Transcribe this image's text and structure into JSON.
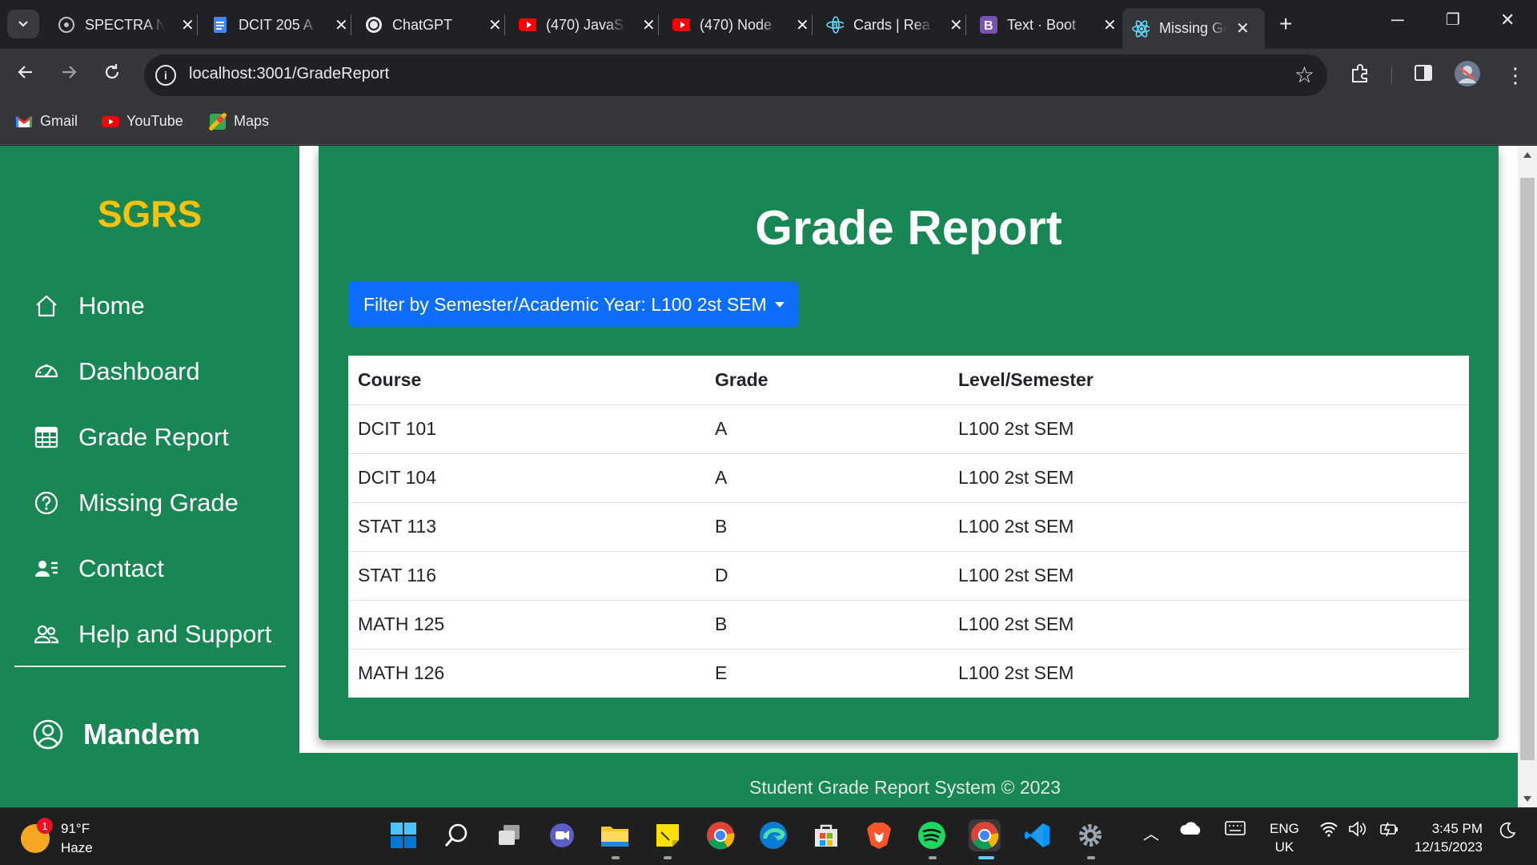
{
  "browser": {
    "tabs": [
      {
        "title": "SPECTRA N",
        "icon": "spectra-icon"
      },
      {
        "title": "DCIT 205 A",
        "icon": "docs-icon"
      },
      {
        "title": "ChatGPT",
        "icon": "chatgpt-icon"
      },
      {
        "title": "(470) JavaS",
        "icon": "youtube-icon"
      },
      {
        "title": "(470) Node",
        "icon": "youtube-icon"
      },
      {
        "title": "Cards | Rea",
        "icon": "react-bootstrap-icon"
      },
      {
        "title": "Text · Boot",
        "icon": "bootstrap-icon"
      },
      {
        "title": "Missing Gr",
        "icon": "react-icon"
      }
    ],
    "url": "localhost:3001/GradeReport",
    "bookmarks": [
      {
        "label": "Gmail",
        "icon": "gmail-icon"
      },
      {
        "label": "YouTube",
        "icon": "youtube-icon"
      },
      {
        "label": "Maps",
        "icon": "maps-icon"
      }
    ]
  },
  "sidebar": {
    "brand": "SGRS",
    "items": [
      {
        "label": "Home",
        "icon": "home-icon"
      },
      {
        "label": "Dashboard",
        "icon": "speedometer-icon"
      },
      {
        "label": "Grade Report",
        "icon": "table-icon"
      },
      {
        "label": "Missing Grade",
        "icon": "question-circle-icon"
      },
      {
        "label": "Contact",
        "icon": "person-lines-icon"
      },
      {
        "label": "Help and Support",
        "icon": "people-icon"
      }
    ],
    "user": {
      "name": "Mandem",
      "icon": "person-circle-icon"
    }
  },
  "main": {
    "title": "Grade Report",
    "filter_button": "Filter by Semester/Academic Year: L100 2st SEM",
    "table": {
      "headers": [
        "Course",
        "Grade",
        "Level/Semester"
      ],
      "rows": [
        [
          "DCIT 101",
          "A",
          "L100 2st SEM"
        ],
        [
          "DCIT 104",
          "A",
          "L100 2st SEM"
        ],
        [
          "STAT 113",
          "B",
          "L100 2st SEM"
        ],
        [
          "STAT 116",
          "D",
          "L100 2st SEM"
        ],
        [
          "MATH 125",
          "B",
          "L100 2st SEM"
        ],
        [
          "MATH 126",
          "E",
          "L100 2st SEM"
        ]
      ]
    }
  },
  "footer": {
    "text": "Student Grade Report System © 2023"
  },
  "taskbar": {
    "weather": {
      "temp": "91°F",
      "condition": "Haze",
      "badge": "1"
    },
    "language": {
      "line1": "ENG",
      "line2": "UK"
    },
    "time": "3:45 PM",
    "date": "12/15/2023"
  },
  "colors": {
    "sidebar": "#198754",
    "brand": "#ffc107",
    "filter_button": "#0d6efd"
  }
}
